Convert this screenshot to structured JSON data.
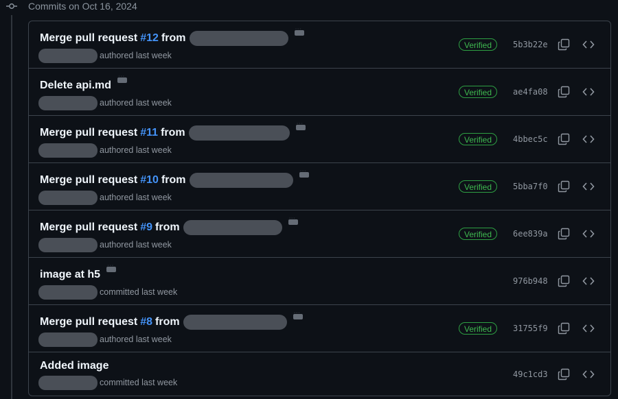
{
  "group": {
    "title": "Commits on Oct 16, 2024"
  },
  "commits": [
    {
      "title_prefix": "Merge pull request ",
      "pr": "#12",
      "title_suffix": " from",
      "has_pr": true,
      "name_redact": true,
      "meta": "authored last week",
      "verified": "Verified",
      "sha": "5b3b22e"
    },
    {
      "title_prefix": "Delete api.md",
      "pr": "",
      "title_suffix": "",
      "has_pr": false,
      "name_redact": false,
      "meta": "authored last week",
      "verified": "Verified",
      "sha": "ae4fa08"
    },
    {
      "title_prefix": "Merge pull request ",
      "pr": "#11",
      "title_suffix": " from",
      "has_pr": true,
      "name_redact": true,
      "meta": "authored last week",
      "verified": "Verified",
      "sha": "4bbec5c"
    },
    {
      "title_prefix": "Merge pull request ",
      "pr": "#10",
      "title_suffix": " from",
      "has_pr": true,
      "name_redact": true,
      "meta": "authored last week",
      "verified": "Verified",
      "sha": "5bba7f0"
    },
    {
      "title_prefix": "Merge pull request ",
      "pr": "#9",
      "title_suffix": " from",
      "has_pr": true,
      "name_redact": true,
      "meta": "authored last week",
      "verified": "Verified",
      "sha": "6ee839a"
    },
    {
      "title_prefix": "image at h5",
      "pr": "",
      "title_suffix": "",
      "has_pr": false,
      "name_redact": false,
      "meta": "committed last week",
      "verified": "",
      "sha": "976b948"
    },
    {
      "title_prefix": "Merge pull request ",
      "pr": "#8",
      "title_suffix": " from",
      "has_pr": true,
      "name_redact": true,
      "meta": "authored last week",
      "verified": "Verified",
      "sha": "31755f9"
    },
    {
      "title_prefix": "Added image",
      "pr": "",
      "title_suffix": "",
      "has_pr": false,
      "name_redact": false,
      "meta": "committed last week",
      "verified": "",
      "sha": "49c1cd3"
    }
  ],
  "icons": {
    "commit": "git-commit-icon",
    "more": "ellipsis-icon",
    "copy": "copy-icon",
    "browse": "code-icon"
  },
  "colors": {
    "accent_link": "#4493f8",
    "verified": "#3fb950",
    "background": "#0d1117",
    "border": "#3d444d"
  }
}
